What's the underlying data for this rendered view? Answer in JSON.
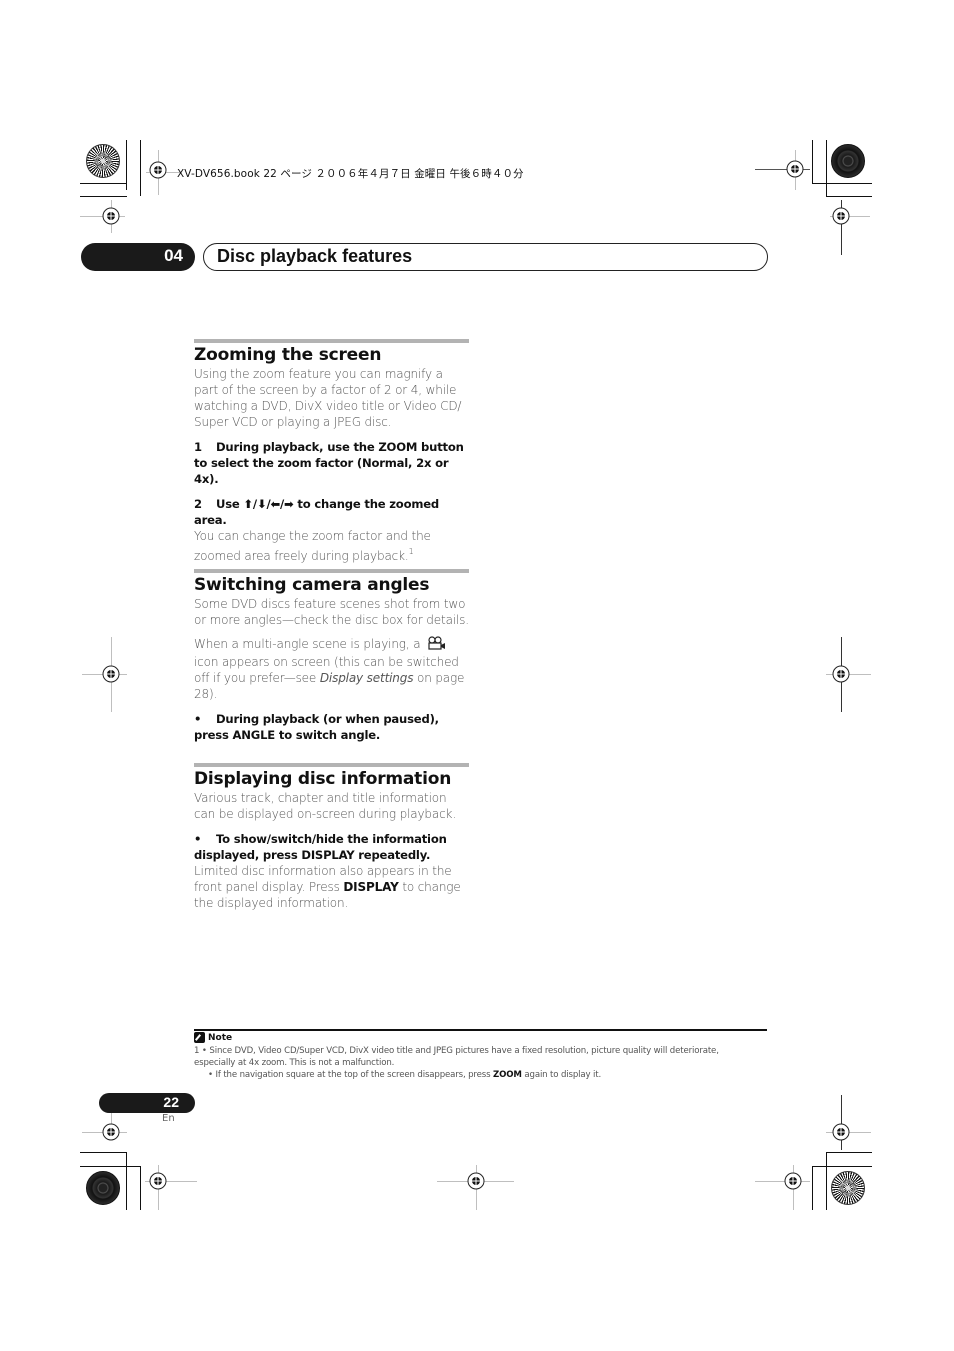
{
  "slug_line": "XV-DV656.book  22 ページ  ２００６年４月７日  金曜日  午後６時４０分",
  "chapter": {
    "number": "04",
    "title": "Disc playback features"
  },
  "sections": [
    {
      "heading": "Zooming the screen",
      "intro": "Using the zoom feature you can magnify a part of the screen by a factor of 2 or 4, while watching a DVD, DivX video title or Video CD/ Super VCD or playing a JPEG disc.",
      "steps": [
        {
          "num": "1",
          "text": "During playback, use the ZOOM button to select the zoom factor (Normal, 2x or 4x)."
        },
        {
          "num": "2",
          "text": "Use ⬆/⬇/⬅/➡ to change the zoomed area."
        }
      ],
      "after_text": "You can change the zoom factor and the zoomed area freely during playback.",
      "footnote_ref": "1"
    },
    {
      "heading": "Switching camera angles",
      "para1": "Some DVD discs feature scenes shot from two or more angles—check the disc box for details.",
      "para2_a": "When a multi-angle scene is playing, a",
      "para2_b": "icon appears on screen (this can be switched off if you prefer—see",
      "para2_link": "Display settings",
      "para2_c": "on page 28).",
      "bullet": "During playback (or when paused), press ANGLE to switch angle."
    },
    {
      "heading": "Displaying disc information",
      "intro": "Various track, chapter and title information can be displayed on-screen during playback.",
      "bullet": "To show/switch/hide the information displayed, press DISPLAY repeatedly.",
      "after_a": "Limited disc information also appears in the front panel display. Press",
      "after_bold": "DISPLAY",
      "after_b": "to change the displayed information."
    }
  ],
  "note": {
    "label": "Note",
    "line1": "1  • Since DVD, Video CD/Super VCD, DivX video title and JPEG pictures have a fixed resolution, picture quality will deteriorate,",
    "line2": "especially at 4x zoom. This is not a malfunction.",
    "line3_a": "• If the navigation square at the top of the screen disappears, press",
    "line3_bold": "ZOOM",
    "line3_b": "again to display it."
  },
  "page": {
    "number": "22",
    "lang": "En"
  },
  "icons": {
    "angle_icon": "camera-angle-icon",
    "note_icon": "pencil-note-icon"
  }
}
